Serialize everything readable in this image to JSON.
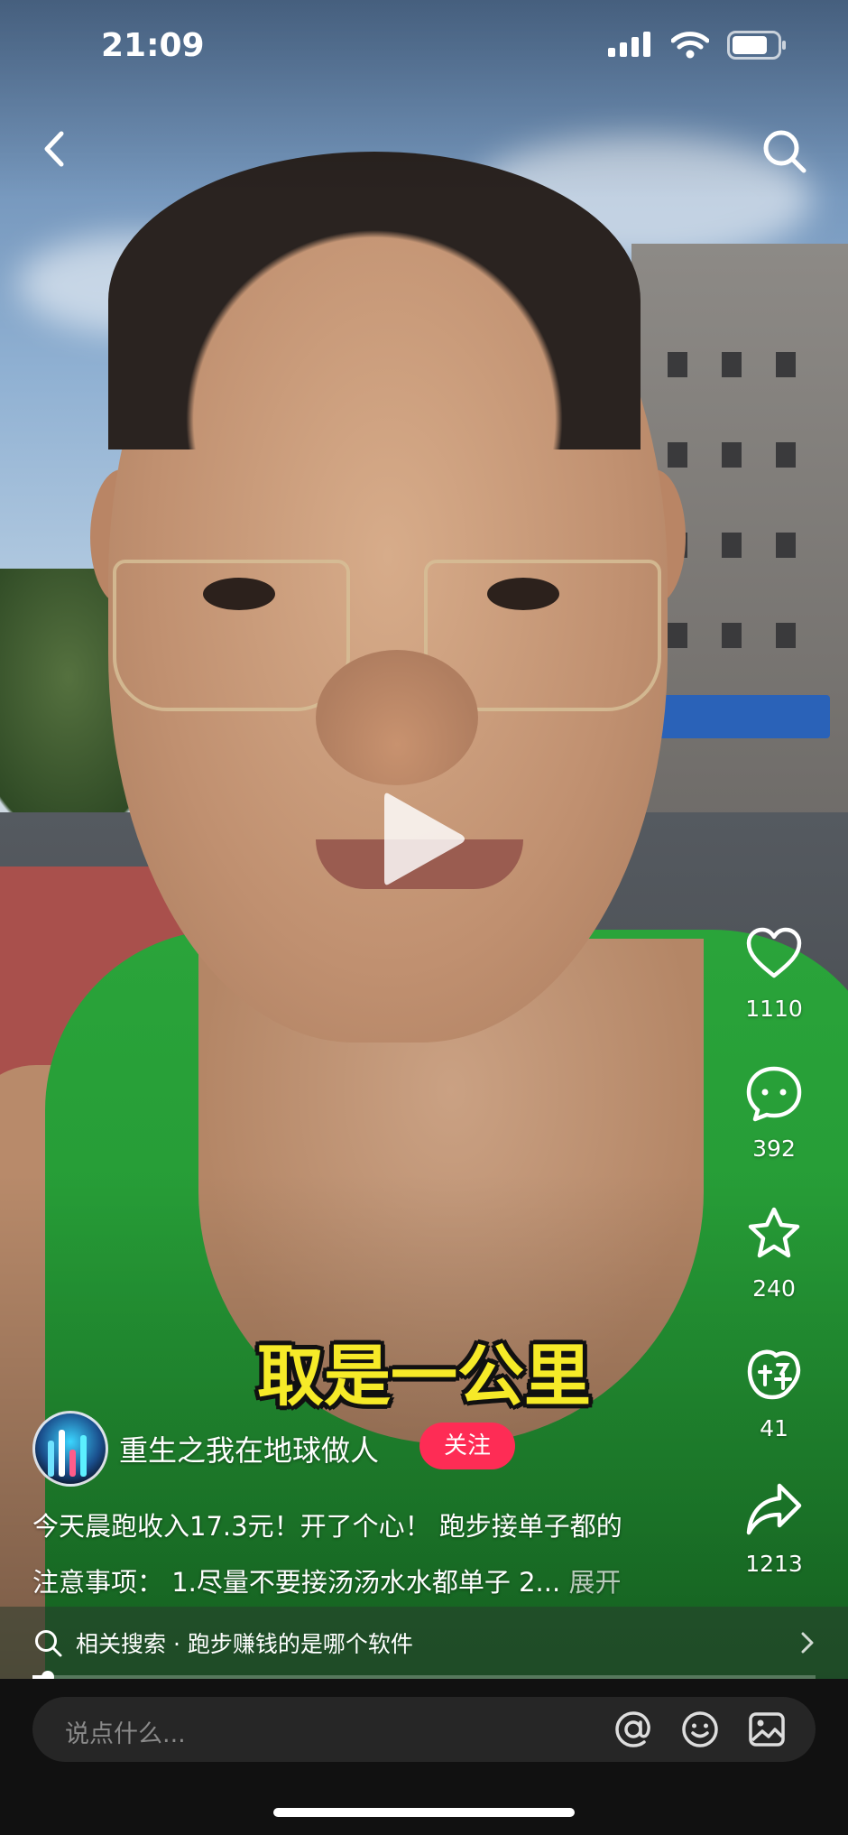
{
  "status_bar": {
    "time": "21:09"
  },
  "top_bar": {
    "back_icon": "chevron-left-icon",
    "search_icon": "search-icon"
  },
  "video": {
    "play_icon": "play-icon",
    "subtitle": "取是一公里",
    "progress": 0.02
  },
  "actions": {
    "like_count": "1110",
    "comment_count": "392",
    "favorite_count": "240",
    "reaction_count": "41",
    "share_count": "1213"
  },
  "author": {
    "name": "重生之我在地球做人",
    "follow_label": "关注"
  },
  "caption": {
    "line1": "今天晨跑收入17.3元！开了个心！ 跑步接单子都的",
    "line2": "注意事项： 1.尽量不要接汤汤水水都单子 2...",
    "more_label": "展开"
  },
  "related_search": {
    "text": "相关搜索 · 跑步赚钱的是哪个软件"
  },
  "comment_bar": {
    "placeholder": "说点什么...",
    "icons": [
      "at-icon",
      "emoji-icon",
      "image-icon"
    ]
  },
  "colors": {
    "accent": "#fe2c55",
    "subtitle": "#f6ea28"
  }
}
